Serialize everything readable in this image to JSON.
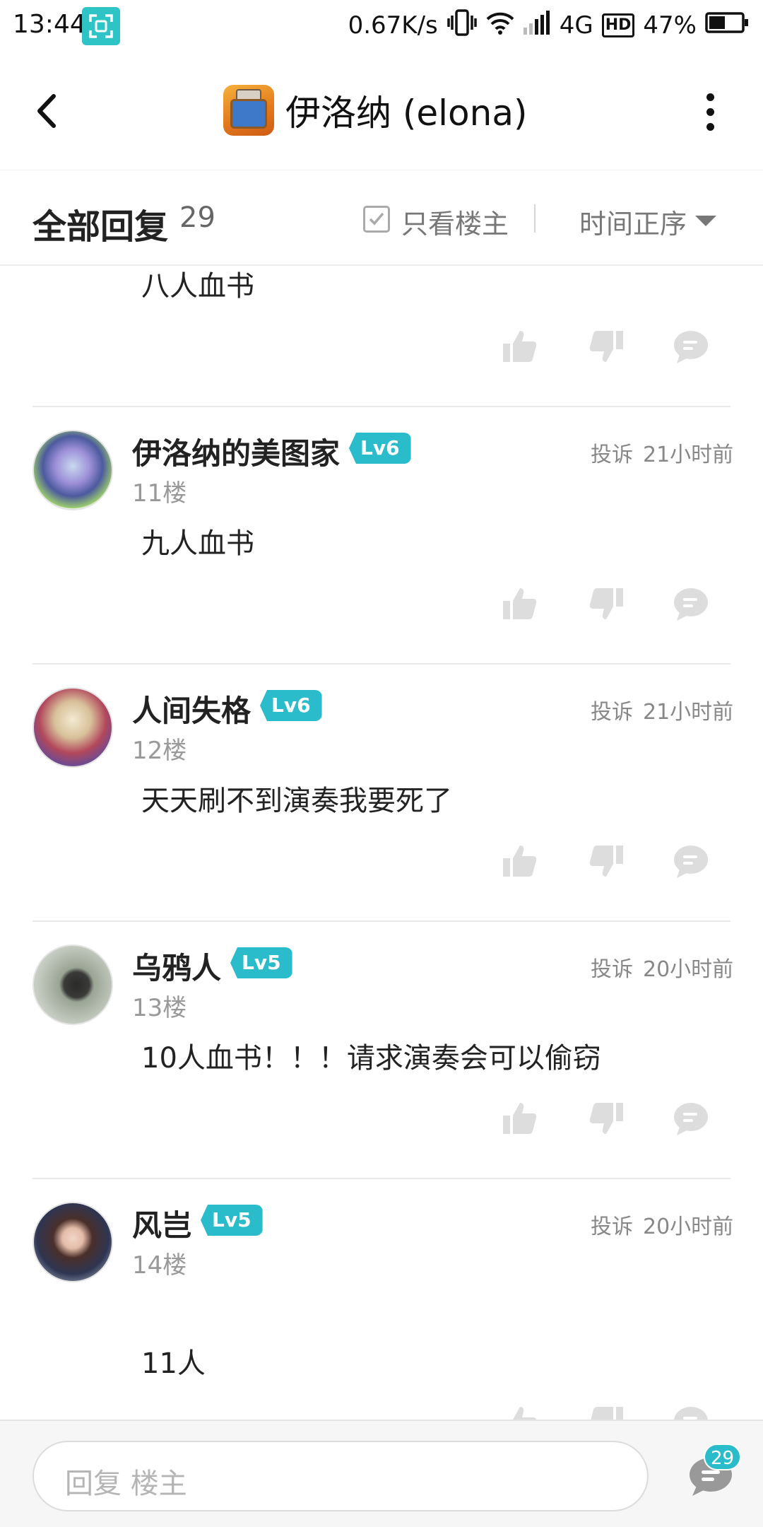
{
  "status_bar": {
    "time": "13:44",
    "net_speed": "0.67K/s",
    "network": "4G",
    "hd": "HD",
    "battery": "47%"
  },
  "header": {
    "title": "伊洛纳 (elona)",
    "back_icon": "chevron-left-icon",
    "menu_icon": "more-vertical-icon"
  },
  "filter": {
    "title": "全部回复",
    "count": "29",
    "only_owner": "只看楼主",
    "sort": "时间正序"
  },
  "posts": [
    {
      "text": "八人血书"
    },
    {
      "name": "伊洛纳的美图家",
      "level": "Lv6",
      "floor": "11楼",
      "report": "投诉",
      "time": "21小时前",
      "text": "九人血书"
    },
    {
      "name": "人间失格",
      "level": "Lv6",
      "floor": "12楼",
      "report": "投诉",
      "time": "21小时前",
      "text": "天天刷不到演奏我要死了"
    },
    {
      "name": "乌鸦人",
      "level": "Lv5",
      "floor": "13楼",
      "report": "投诉",
      "time": "20小时前",
      "text": "10人血书！！！请求演奏会可以偷窃"
    },
    {
      "name": "风岂",
      "level": "Lv5",
      "floor": "14楼",
      "report": "投诉",
      "time": "20小时前",
      "text": "11人"
    }
  ],
  "bottom": {
    "reply_placeholder": "回复  楼主",
    "comment_count": "29"
  },
  "colors": {
    "accent": "#2bbccb",
    "icon_gray": "#dddddd"
  }
}
